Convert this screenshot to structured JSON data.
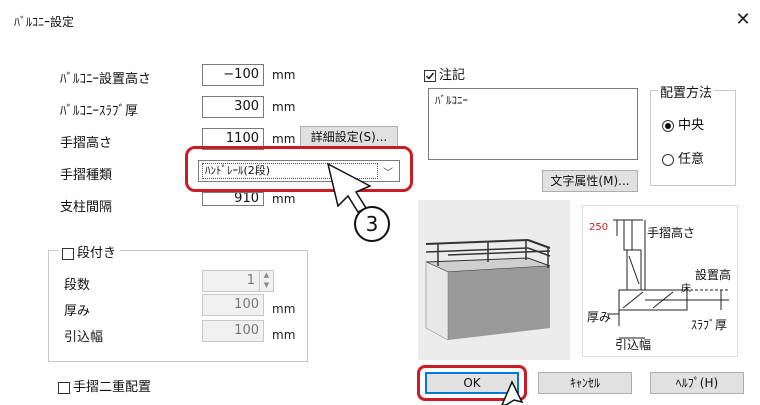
{
  "window": {
    "title": "ﾊﾞﾙｺﾆｰ設定",
    "close_glyph": "✕"
  },
  "form": {
    "install_height": {
      "label": "ﾊﾞﾙｺﾆｰ設置高さ",
      "value": "−100",
      "unit": "mm"
    },
    "slab_thickness": {
      "label": "ﾊﾞﾙｺﾆｰｽﾗﾌﾞ厚",
      "value": "300",
      "unit": "mm"
    },
    "handrail_height": {
      "label": "手摺高さ",
      "value": "1100",
      "unit": "mm",
      "detail_button": "詳細設定(S)..."
    },
    "handrail_type": {
      "label": "手摺種類",
      "selected": "ﾊﾝﾄﾞﾚｰﾙ(2段)"
    },
    "post_interval": {
      "label": "支柱間隔",
      "value": "910",
      "unit": "mm"
    }
  },
  "steps": {
    "checkbox_label": "段付き",
    "count": {
      "label": "段数",
      "value": "1"
    },
    "thickness": {
      "label": "厚み",
      "value": "100",
      "unit": "mm"
    },
    "setback": {
      "label": "引込幅",
      "value": "100",
      "unit": "mm"
    }
  },
  "double_handrail": {
    "label": "手摺二重配置"
  },
  "note": {
    "checkbox_label": "注記",
    "checked": true,
    "text": "ﾊﾞﾙｺﾆｰ",
    "text_attr_button": "文字属性(M)..."
  },
  "placement": {
    "title": "配置方法",
    "options": [
      {
        "label": "中央",
        "selected": true
      },
      {
        "label": "任意",
        "selected": false
      }
    ]
  },
  "diagram_labels": {
    "height_value": "250",
    "handrail_height": "手摺高さ",
    "install_height": "設置高",
    "floor": "床",
    "thickness": "厚み",
    "slab": "ｽﾗﾌﾞ厚",
    "setback": "引込幅"
  },
  "buttons": {
    "ok": "OK",
    "cancel": "ｷｬﾝｾﾙ",
    "help": "ﾍﾙﾌﾟ(H)"
  },
  "annotation": {
    "step_number": "3"
  },
  "colors": {
    "highlight_red": "#c91c24",
    "ok_blue": "#0078d7"
  }
}
